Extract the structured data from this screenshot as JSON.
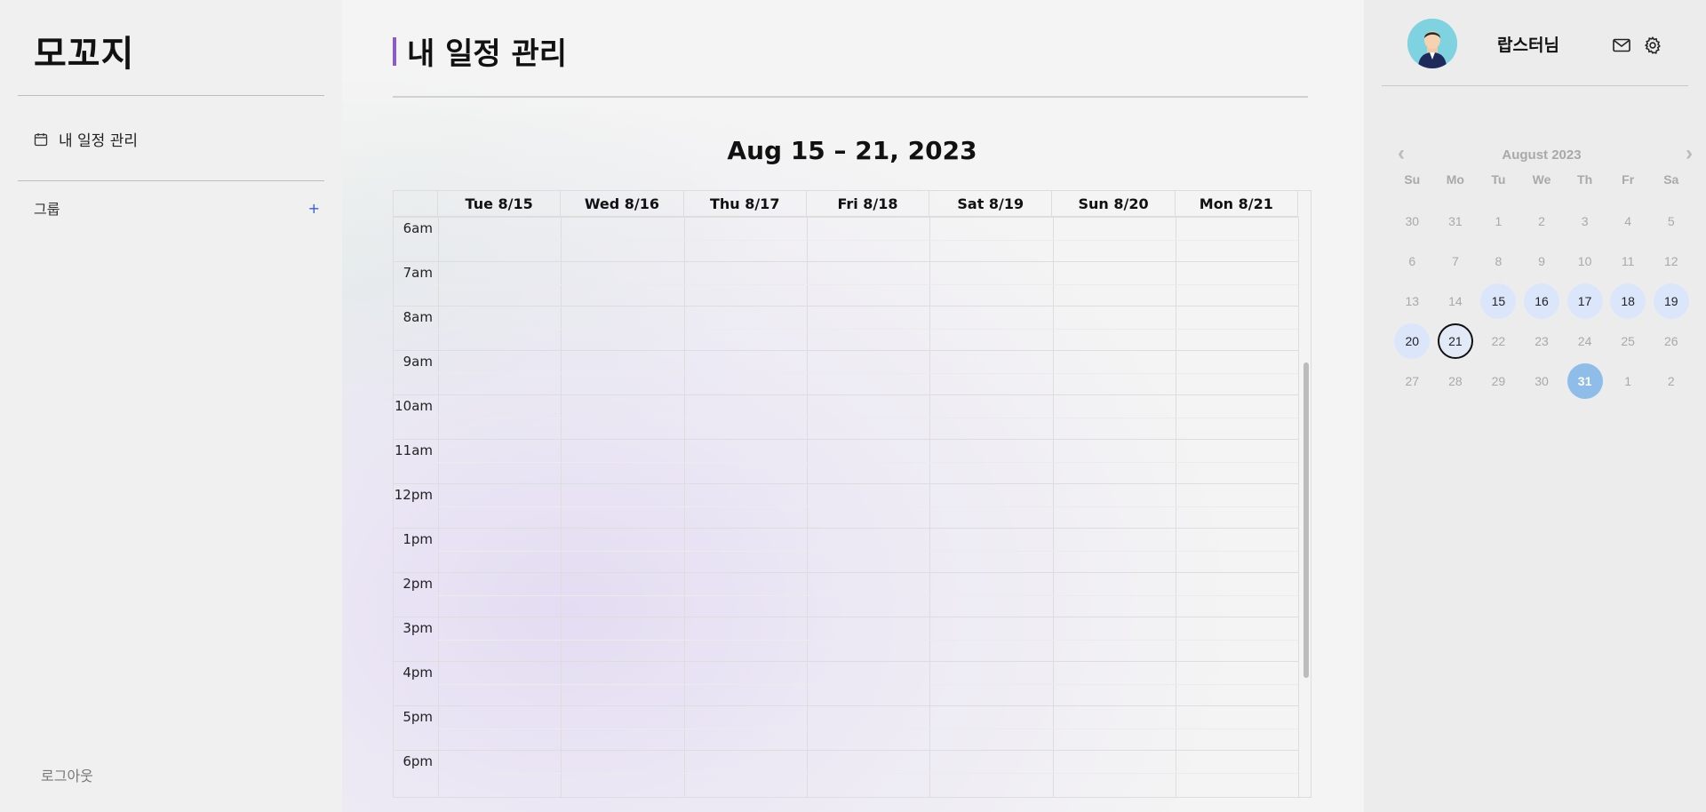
{
  "sidebar": {
    "logo": "모꼬지",
    "nav_item": "내 일정 관리",
    "group_label": "그룹",
    "group_add": "+",
    "logout": "로그아웃"
  },
  "main": {
    "title": "내 일정 관리",
    "week_range": "Aug 15 – 21, 2023",
    "days": [
      "Tue 8/15",
      "Wed 8/16",
      "Thu 8/17",
      "Fri 8/18",
      "Sat 8/19",
      "Sun 8/20",
      "Mon 8/21"
    ],
    "hours": [
      "6am",
      "7am",
      "8am",
      "9am",
      "10am",
      "11am",
      "12pm",
      "1pm",
      "2pm",
      "3pm",
      "4pm",
      "5pm",
      "6pm"
    ]
  },
  "right": {
    "username": "랍스터님",
    "mail_icon": "mail-icon",
    "settings_icon": "gear-icon",
    "mini_calendar": {
      "month_label": "August 2023",
      "prev": "‹",
      "next": "›",
      "weekdays": [
        "Su",
        "Mo",
        "Tu",
        "We",
        "Th",
        "Fr",
        "Sa"
      ],
      "weeks": [
        [
          "30",
          "31",
          "1",
          "2",
          "3",
          "4",
          "5"
        ],
        [
          "6",
          "7",
          "8",
          "9",
          "10",
          "11",
          "12"
        ],
        [
          "13",
          "14",
          "15",
          "16",
          "17",
          "18",
          "19"
        ],
        [
          "20",
          "21",
          "22",
          "23",
          "24",
          "25",
          "26"
        ],
        [
          "27",
          "28",
          "29",
          "30",
          "31",
          "1",
          "2"
        ]
      ],
      "highlight_week_cells": [
        [
          2,
          2
        ],
        [
          2,
          3
        ],
        [
          2,
          4
        ],
        [
          2,
          5
        ],
        [
          2,
          6
        ],
        [
          3,
          0
        ]
      ],
      "today_cell": [
        3,
        1
      ],
      "selected_cell": [
        4,
        4
      ]
    }
  },
  "colors": {
    "accent_bar": "#8a5cc9",
    "week_highlight": "#dce6fb",
    "selected_day": "#8fbde9",
    "group_add": "#3a5bd9"
  }
}
